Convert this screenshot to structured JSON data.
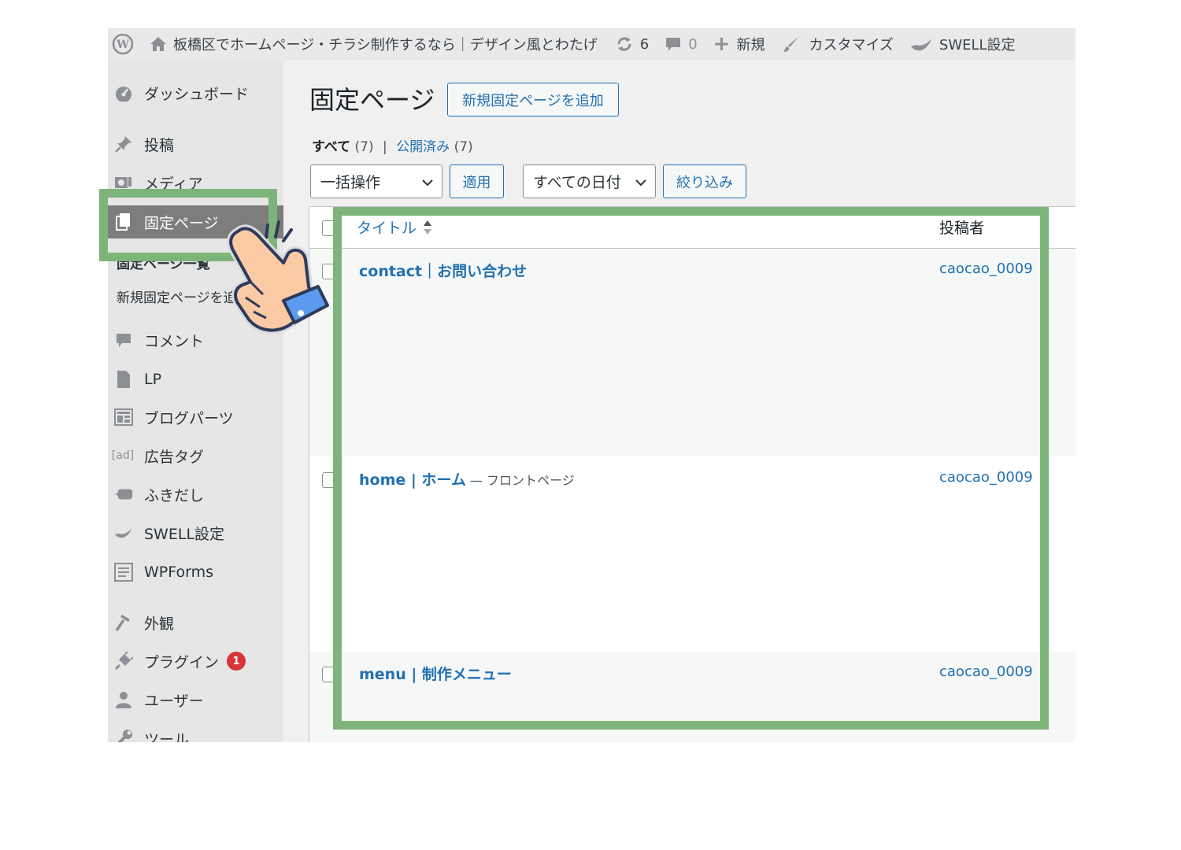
{
  "adminbar": {
    "site_name": "板橋区でホームページ・チラシ制作するなら｜デザイン風とわたげ",
    "updates_count": "6",
    "comments_count": "0",
    "new_label": "新規",
    "customize_label": "カスタマイズ",
    "swell_label": "SWELL設定"
  },
  "sidebar": {
    "dashboard": "ダッシュボード",
    "posts": "投稿",
    "media": "メディア",
    "pages": "固定ページ",
    "pages_all": "固定ページ一覧",
    "pages_new": "新規固定ページを追加",
    "comments": "コメント",
    "lp": "LP",
    "blog_parts": "ブログパーツ",
    "ad_tag_icon": "[ad]",
    "ad_tag": "広告タグ",
    "balloon": "ふきだし",
    "swell": "SWELL設定",
    "wpforms": "WPForms",
    "appearance": "外観",
    "plugins": "プラグイン",
    "plugins_badge": "1",
    "users": "ユーザー",
    "tools": "ツール"
  },
  "main": {
    "title": "固定ページ",
    "add_new_button": "新規固定ページを追加",
    "views": {
      "all_label": "すべて",
      "all_count": "(7)",
      "separator": "|",
      "published_label": "公開済み",
      "published_count": "(7)"
    },
    "bulk_action": "一括操作",
    "apply_button": "適用",
    "date_filter": "すべての日付",
    "filter_button": "絞り込み",
    "table": {
      "col_title": "タイトル",
      "col_author": "投稿者",
      "rows": [
        {
          "title": "contact｜お問い合わせ",
          "state": "",
          "author": "caocao_0009"
        },
        {
          "title": "home | ホーム",
          "state": " — フロントページ",
          "author": "caocao_0009"
        },
        {
          "title": "menu | 制作メニュー",
          "state": "",
          "author": "caocao_0009"
        }
      ]
    }
  },
  "colors": {
    "highlight": "#7db479",
    "link": "#2271b1",
    "active_menu": "#7d7d7d",
    "badge": "#d63638"
  }
}
